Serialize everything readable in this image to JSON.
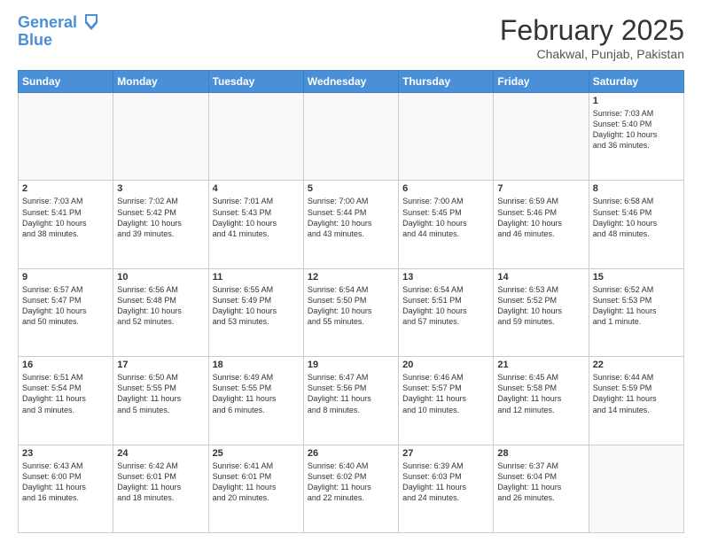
{
  "header": {
    "logo_line1": "General",
    "logo_line2": "Blue",
    "month_year": "February 2025",
    "location": "Chakwal, Punjab, Pakistan"
  },
  "weekdays": [
    "Sunday",
    "Monday",
    "Tuesday",
    "Wednesday",
    "Thursday",
    "Friday",
    "Saturday"
  ],
  "weeks": [
    [
      {
        "day": "",
        "info": ""
      },
      {
        "day": "",
        "info": ""
      },
      {
        "day": "",
        "info": ""
      },
      {
        "day": "",
        "info": ""
      },
      {
        "day": "",
        "info": ""
      },
      {
        "day": "",
        "info": ""
      },
      {
        "day": "1",
        "info": "Sunrise: 7:03 AM\nSunset: 5:40 PM\nDaylight: 10 hours\nand 36 minutes."
      }
    ],
    [
      {
        "day": "2",
        "info": "Sunrise: 7:03 AM\nSunset: 5:41 PM\nDaylight: 10 hours\nand 38 minutes."
      },
      {
        "day": "3",
        "info": "Sunrise: 7:02 AM\nSunset: 5:42 PM\nDaylight: 10 hours\nand 39 minutes."
      },
      {
        "day": "4",
        "info": "Sunrise: 7:01 AM\nSunset: 5:43 PM\nDaylight: 10 hours\nand 41 minutes."
      },
      {
        "day": "5",
        "info": "Sunrise: 7:00 AM\nSunset: 5:44 PM\nDaylight: 10 hours\nand 43 minutes."
      },
      {
        "day": "6",
        "info": "Sunrise: 7:00 AM\nSunset: 5:45 PM\nDaylight: 10 hours\nand 44 minutes."
      },
      {
        "day": "7",
        "info": "Sunrise: 6:59 AM\nSunset: 5:46 PM\nDaylight: 10 hours\nand 46 minutes."
      },
      {
        "day": "8",
        "info": "Sunrise: 6:58 AM\nSunset: 5:46 PM\nDaylight: 10 hours\nand 48 minutes."
      }
    ],
    [
      {
        "day": "9",
        "info": "Sunrise: 6:57 AM\nSunset: 5:47 PM\nDaylight: 10 hours\nand 50 minutes."
      },
      {
        "day": "10",
        "info": "Sunrise: 6:56 AM\nSunset: 5:48 PM\nDaylight: 10 hours\nand 52 minutes."
      },
      {
        "day": "11",
        "info": "Sunrise: 6:55 AM\nSunset: 5:49 PM\nDaylight: 10 hours\nand 53 minutes."
      },
      {
        "day": "12",
        "info": "Sunrise: 6:54 AM\nSunset: 5:50 PM\nDaylight: 10 hours\nand 55 minutes."
      },
      {
        "day": "13",
        "info": "Sunrise: 6:54 AM\nSunset: 5:51 PM\nDaylight: 10 hours\nand 57 minutes."
      },
      {
        "day": "14",
        "info": "Sunrise: 6:53 AM\nSunset: 5:52 PM\nDaylight: 10 hours\nand 59 minutes."
      },
      {
        "day": "15",
        "info": "Sunrise: 6:52 AM\nSunset: 5:53 PM\nDaylight: 11 hours\nand 1 minute."
      }
    ],
    [
      {
        "day": "16",
        "info": "Sunrise: 6:51 AM\nSunset: 5:54 PM\nDaylight: 11 hours\nand 3 minutes."
      },
      {
        "day": "17",
        "info": "Sunrise: 6:50 AM\nSunset: 5:55 PM\nDaylight: 11 hours\nand 5 minutes."
      },
      {
        "day": "18",
        "info": "Sunrise: 6:49 AM\nSunset: 5:55 PM\nDaylight: 11 hours\nand 6 minutes."
      },
      {
        "day": "19",
        "info": "Sunrise: 6:47 AM\nSunset: 5:56 PM\nDaylight: 11 hours\nand 8 minutes."
      },
      {
        "day": "20",
        "info": "Sunrise: 6:46 AM\nSunset: 5:57 PM\nDaylight: 11 hours\nand 10 minutes."
      },
      {
        "day": "21",
        "info": "Sunrise: 6:45 AM\nSunset: 5:58 PM\nDaylight: 11 hours\nand 12 minutes."
      },
      {
        "day": "22",
        "info": "Sunrise: 6:44 AM\nSunset: 5:59 PM\nDaylight: 11 hours\nand 14 minutes."
      }
    ],
    [
      {
        "day": "23",
        "info": "Sunrise: 6:43 AM\nSunset: 6:00 PM\nDaylight: 11 hours\nand 16 minutes."
      },
      {
        "day": "24",
        "info": "Sunrise: 6:42 AM\nSunset: 6:01 PM\nDaylight: 11 hours\nand 18 minutes."
      },
      {
        "day": "25",
        "info": "Sunrise: 6:41 AM\nSunset: 6:01 PM\nDaylight: 11 hours\nand 20 minutes."
      },
      {
        "day": "26",
        "info": "Sunrise: 6:40 AM\nSunset: 6:02 PM\nDaylight: 11 hours\nand 22 minutes."
      },
      {
        "day": "27",
        "info": "Sunrise: 6:39 AM\nSunset: 6:03 PM\nDaylight: 11 hours\nand 24 minutes."
      },
      {
        "day": "28",
        "info": "Sunrise: 6:37 AM\nSunset: 6:04 PM\nDaylight: 11 hours\nand 26 minutes."
      },
      {
        "day": "",
        "info": ""
      }
    ]
  ]
}
